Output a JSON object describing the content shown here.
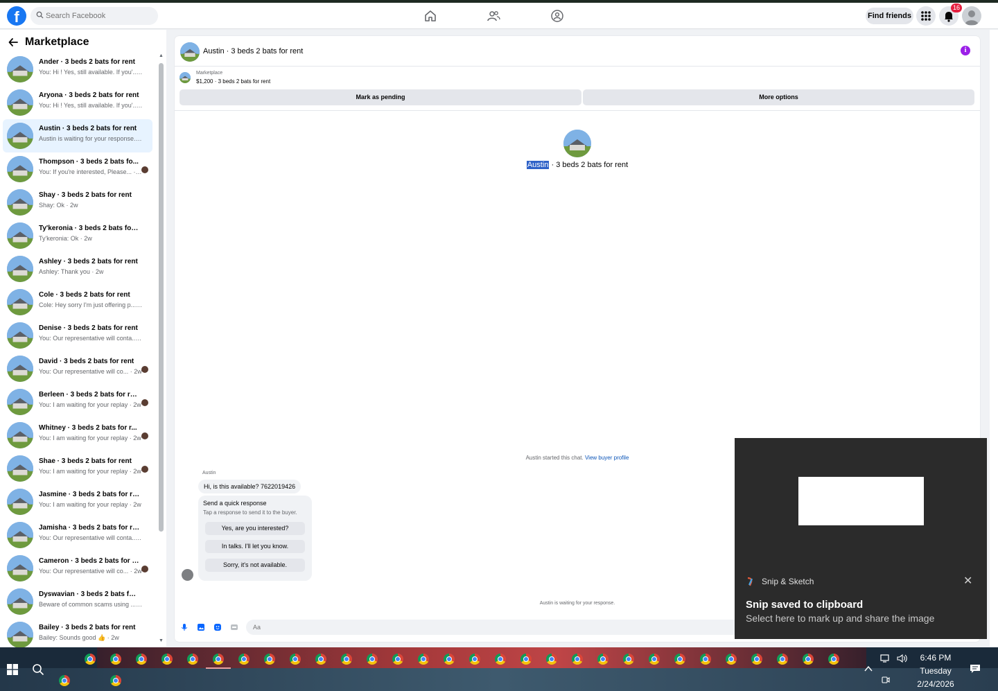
{
  "topbar": {
    "search_placeholder": "Search Facebook",
    "find_friends": "Find friends",
    "notification_count": "16"
  },
  "sidebar": {
    "title": "Marketplace",
    "conversations": [
      {
        "title": "Ander · 3 beds 2 bats for rent",
        "sub": "You: Hi ! Yes, still available. If you'... · 1m",
        "active": false
      },
      {
        "title": "Aryona · 3 beds 2 bats for rent",
        "sub": "You: Hi ! Yes, still available. If you'... · 1m",
        "active": false
      },
      {
        "title": "Austin · 3 beds 2 bats for rent",
        "sub": "Austin is waiting for your response. · 1d",
        "active": true
      },
      {
        "title": "Thompson · 3 beds 2 bats fo...",
        "sub": "You: If you're interested, Please... · 2d",
        "active": false
      },
      {
        "title": "Shay · 3 beds 2 bats for rent",
        "sub": "Shay: Ok · 2w",
        "active": false
      },
      {
        "title": "Ty'keronia · 3 beds 2 bats for re...",
        "sub": "Ty'keronia: Ok · 2w",
        "active": false
      },
      {
        "title": "Ashley · 3 beds 2 bats for rent",
        "sub": "Ashley: Thank you · 2w",
        "active": false
      },
      {
        "title": "Cole · 3 beds 2 bats for rent",
        "sub": "Cole: Hey sorry I'm just offering p... · 2w",
        "active": false
      },
      {
        "title": "Denise · 3 beds 2 bats for rent",
        "sub": "You: Our representative will conta... · 2w",
        "active": false
      },
      {
        "title": "David · 3 beds 2 bats for rent",
        "sub": "You: Our representative will co... · 2w",
        "active": false
      },
      {
        "title": "Berleen · 3 beds 2 bats for rent",
        "sub": "You: I am waiting for your replay · 2w",
        "active": false
      },
      {
        "title": "Whitney · 3 beds 2 bats for r...",
        "sub": "You: I am waiting for your replay · 2w",
        "active": false
      },
      {
        "title": "Shae · 3 beds 2 bats for rent",
        "sub": "You: I am waiting for your replay · 2w",
        "active": false
      },
      {
        "title": "Jasmine · 3 beds 2 bats for rent",
        "sub": "You: I am waiting for your replay · 2w",
        "active": false
      },
      {
        "title": "Jamisha · 3 beds 2 bats for rent",
        "sub": "You: Our representative will conta... · 2w",
        "active": false
      },
      {
        "title": "Cameron · 3 beds 2 bats for r...",
        "sub": "You: Our representative will co... · 2w",
        "active": false
      },
      {
        "title": "Dyswavian · 3 beds 2 bats for r...",
        "sub": "Beware of common scams using ... · 2w",
        "active": false
      },
      {
        "title": "Bailey · 3 beds 2 bats for rent",
        "sub": "Bailey: Sounds good 👍 · 2w",
        "active": false
      }
    ]
  },
  "chat": {
    "header_title": "Austin · 3 beds 2 bats for rent",
    "listing_source": "Marketplace",
    "listing_price": "$1,200 · 3 beds 2 bats for rent",
    "mark_pending": "Mark as pending",
    "more_options": "More options",
    "center_name": "Austin",
    "center_rest": " · 3 beds 2 bats for rent",
    "started_text": "Austin started this chat.",
    "view_buyer_profile": "View buyer profile",
    "sender": "Austin",
    "message": "Hi, is this available? 7622019426",
    "quick_title": "Send a quick response",
    "quick_sub": "Tap a response to send it to the buyer.",
    "quick_1": "Yes, are you interested?",
    "quick_2": "In talks. I'll let you know.",
    "quick_3": "Sorry, it's not available.",
    "waiting": "Austin is waiting for your response.",
    "composer_placeholder": "Aa"
  },
  "toast": {
    "app_name": "Snip & Sketch",
    "title": "Snip saved to clipboard",
    "body": "Select here to mark up and share the image",
    "close": "✕"
  },
  "taskbar": {
    "time": "6:46 PM",
    "day": "Tuesday",
    "date": "2/24/2026"
  }
}
